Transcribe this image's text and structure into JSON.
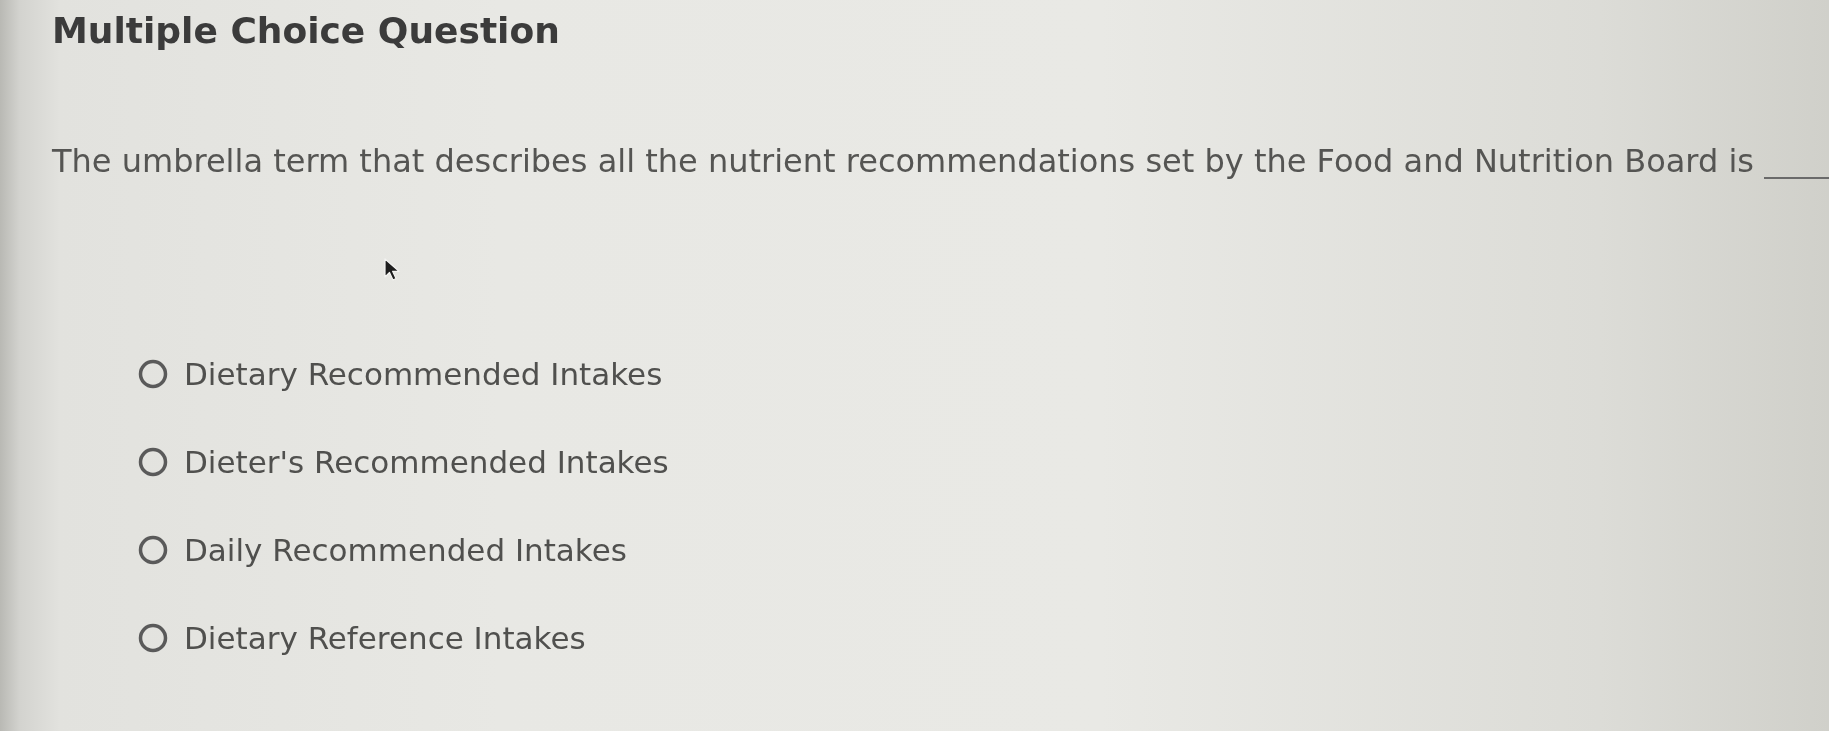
{
  "title": "Multiple Choice Question",
  "question": {
    "text": "The umbrella term that describes all the nutrient recommendations set by the Food and Nutrition Board is",
    "blank": true
  },
  "options": [
    {
      "label": "Dietary Recommended Intakes",
      "selected": false
    },
    {
      "label": "Dieter's Recommended Intakes",
      "selected": false
    },
    {
      "label": "Daily Recommended Intakes",
      "selected": false
    },
    {
      "label": "Dietary Reference Intakes",
      "selected": false
    }
  ]
}
